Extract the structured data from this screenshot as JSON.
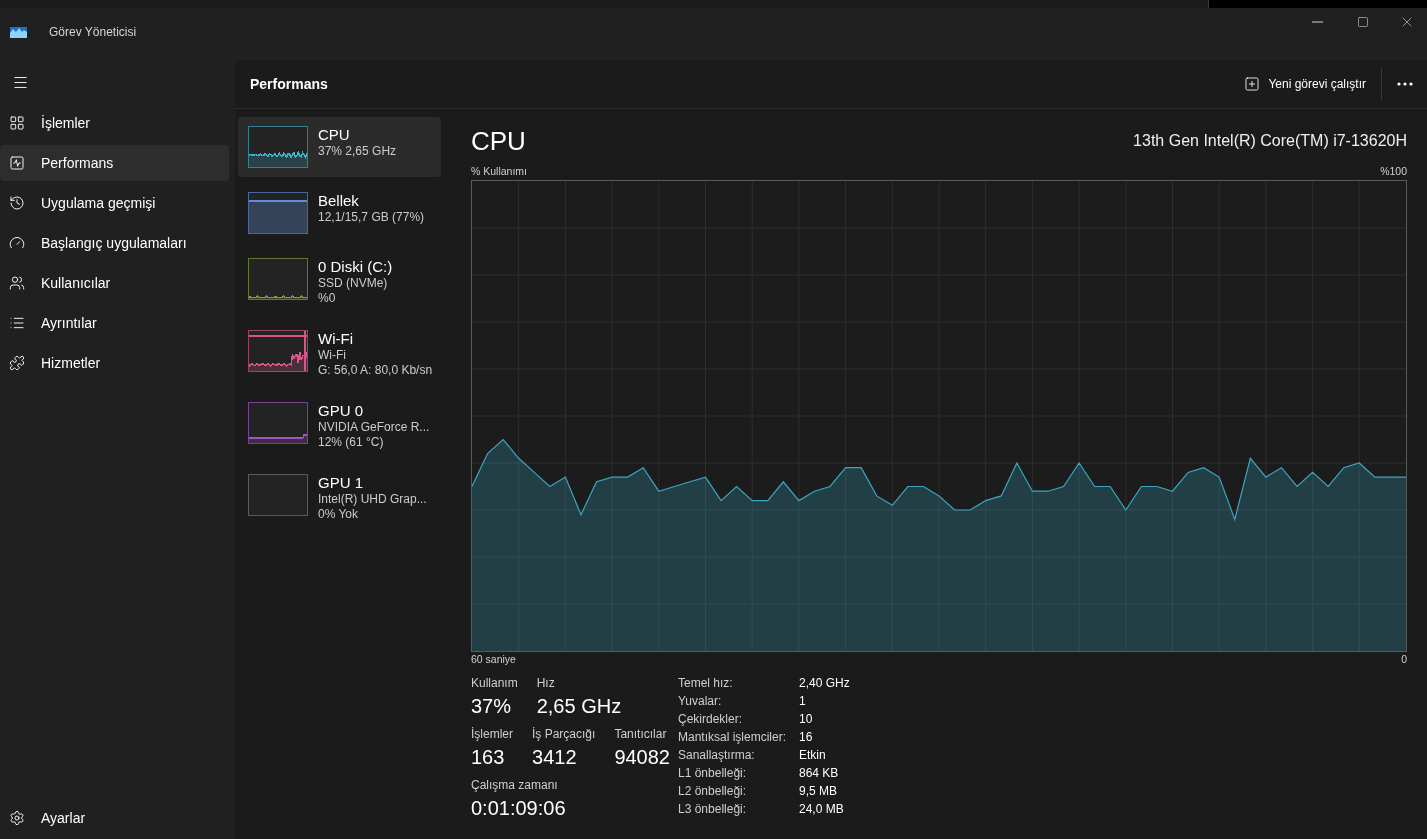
{
  "window": {
    "title": "Görev Yöneticisi"
  },
  "sidebar": {
    "items": [
      {
        "label": "İşlemler",
        "selected": false
      },
      {
        "label": "Performans",
        "selected": true
      },
      {
        "label": "Uygulama geçmişi",
        "selected": false
      },
      {
        "label": "Başlangıç uygulamaları",
        "selected": false
      },
      {
        "label": "Kullanıcılar",
        "selected": false
      },
      {
        "label": "Ayrıntılar",
        "selected": false
      },
      {
        "label": "Hizmetler",
        "selected": false
      }
    ],
    "footer": {
      "label": "Ayarlar"
    }
  },
  "header": {
    "title": "Performans",
    "action": "Yeni görevi çalıştır"
  },
  "devices": [
    {
      "name": "CPU",
      "details": [
        "37% 2,65 GHz"
      ],
      "selected": true,
      "color": "#3fb0c8"
    },
    {
      "name": "Bellek",
      "details": [
        "12,1/15,7 GB (77%)"
      ],
      "selected": false,
      "color": "#5c8fd8"
    },
    {
      "name": "0 Diski (C:)",
      "details": [
        "SSD (NVMe)",
        "%0"
      ],
      "selected": false,
      "color": "#7fa23c"
    },
    {
      "name": "Wi-Fi",
      "details": [
        "Wi-Fi",
        "G: 56,0 A: 80,0 Kb/sn"
      ],
      "selected": false,
      "color": "#d8558c"
    },
    {
      "name": "GPU 0",
      "details": [
        "NVIDIA GeForce R...",
        "12% (61 °C)"
      ],
      "selected": false,
      "color": "#a552c8"
    },
    {
      "name": "GPU 1",
      "details": [
        "Intel(R) UHD Grap...",
        "0% Yok"
      ],
      "selected": false
    }
  ],
  "detail": {
    "title": "CPU",
    "model": "13th Gen Intel(R) Core(TM) i7-13620H",
    "graph": {
      "y_label": "% Kullanımı",
      "y_max_label": "%100",
      "x_start_label": "60 saniye",
      "x_end_label": "0"
    },
    "stats": [
      [
        {
          "label": "Kullanım",
          "value": "37%"
        },
        {
          "label": "Hız",
          "value": "2,65 GHz"
        }
      ],
      [
        {
          "label": "İşlemler",
          "value": "163"
        },
        {
          "label": "İş Parçacığı",
          "value": "3412"
        },
        {
          "label": "Tanıtıcılar",
          "value": "94082"
        }
      ],
      [
        {
          "label": "Çalışma zamanı",
          "value": "0:01:09:06"
        }
      ]
    ],
    "specs": [
      {
        "label": "Temel hız:",
        "value": "2,40 GHz"
      },
      {
        "label": "Yuvalar:",
        "value": "1"
      },
      {
        "label": "Çekirdekler:",
        "value": "10"
      },
      {
        "label": "Mantıksal işlemciler:",
        "value": "16"
      },
      {
        "label": "Sanallaştırma:",
        "value": "Etkin"
      },
      {
        "label": "L1 önbelleği:",
        "value": "864 KB"
      },
      {
        "label": "L2 önbelleği:",
        "value": "9,5 MB"
      },
      {
        "label": "L3 önbelleği:",
        "value": "24,0 MB"
      }
    ]
  }
}
